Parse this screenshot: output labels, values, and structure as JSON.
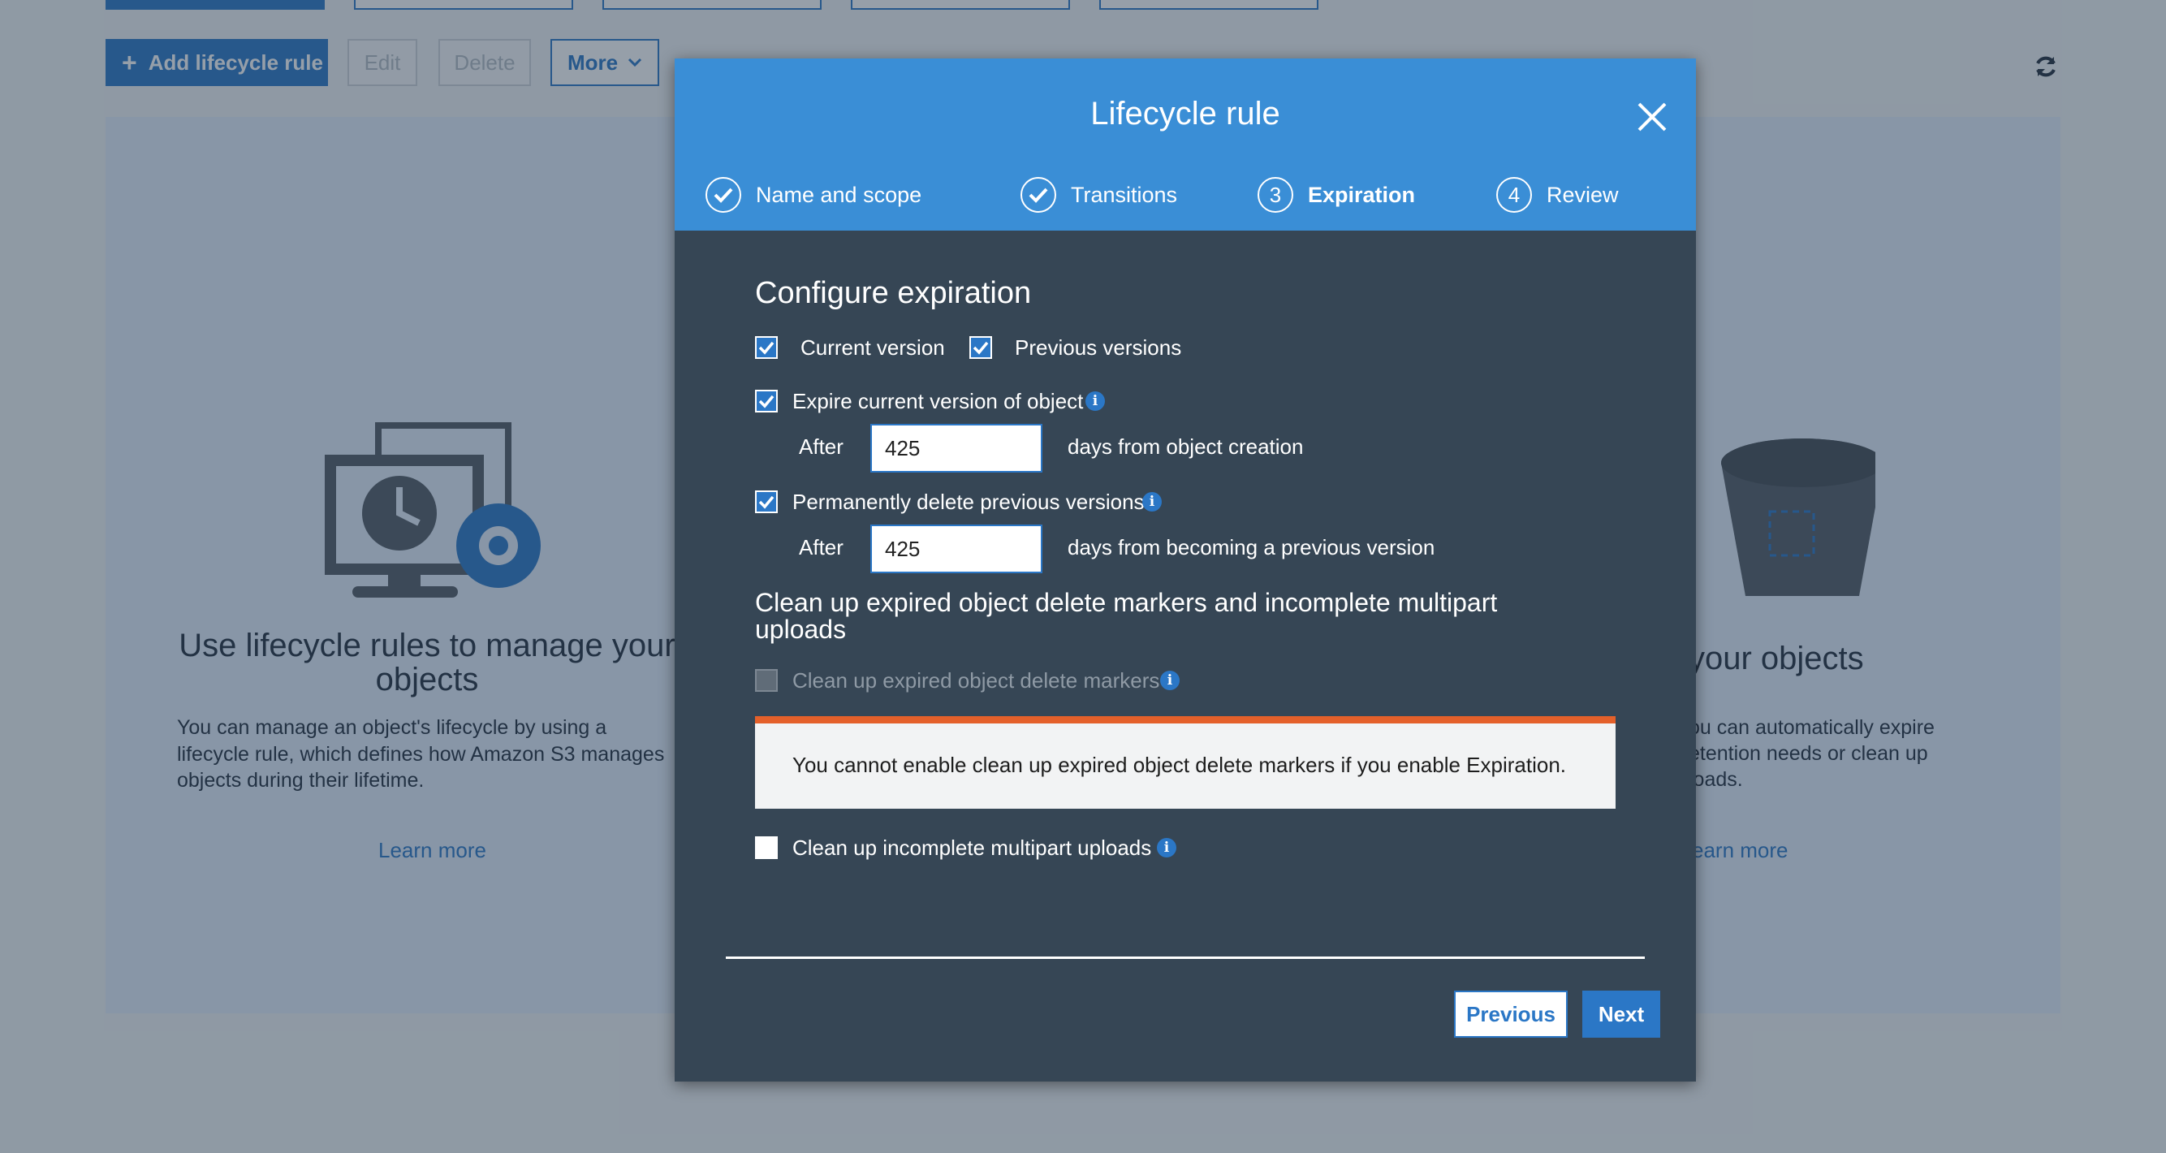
{
  "toolbar": {
    "add_label": "Add lifecycle rule",
    "edit_label": "Edit",
    "delete_label": "Delete",
    "more_label": "More"
  },
  "background": {
    "left_card": {
      "title": "Use lifecycle rules to manage your objects",
      "text": "You can manage an object's lifecycle by using a lifecycle rule, which defines how Amazon S3 manages objects during their lifetime.",
      "link": "Learn more"
    },
    "right_card": {
      "title": "your objects",
      "text_line1": "ou can automatically expire",
      "text_line2": "etention needs or clean up",
      "text_line3": "loads.",
      "link": "earn more"
    }
  },
  "modal": {
    "title": "Lifecycle rule",
    "steps": [
      {
        "num": "",
        "label": "Name and scope",
        "state": "done"
      },
      {
        "num": "",
        "label": "Transitions",
        "state": "done"
      },
      {
        "num": "3",
        "label": "Expiration",
        "state": "current"
      },
      {
        "num": "4",
        "label": "Review",
        "state": "todo"
      }
    ],
    "section_title": "Configure expiration",
    "current_version": "Current version",
    "previous_versions": "Previous versions",
    "expire_current": "Expire current version of object",
    "after_label": "After",
    "expire_days": "425",
    "expire_suffix": "days from object creation",
    "perm_delete": "Permanently delete previous versions",
    "perm_days": "425",
    "perm_suffix": "days from becoming a previous version",
    "cleanup_title": "Clean up expired object delete markers and incomplete multipart uploads",
    "cleanup_markers": "Clean up expired object delete markers",
    "warning": "You cannot enable clean up expired object delete markers if you enable Expiration.",
    "cleanup_multipart": "Clean up incomplete multipart uploads",
    "previous_button": "Previous",
    "next_button": "Next"
  },
  "colors": {
    "accent": "#2b77c6",
    "header": "#3a8ed6",
    "modal_body": "#364655",
    "warning_bar": "#e4602a"
  },
  "icons": [
    "plus-icon",
    "chevron-down-icon",
    "refresh-icon",
    "close-icon",
    "check-icon",
    "info-icon",
    "monitor-clock-gear-icon",
    "bucket-icon"
  ]
}
